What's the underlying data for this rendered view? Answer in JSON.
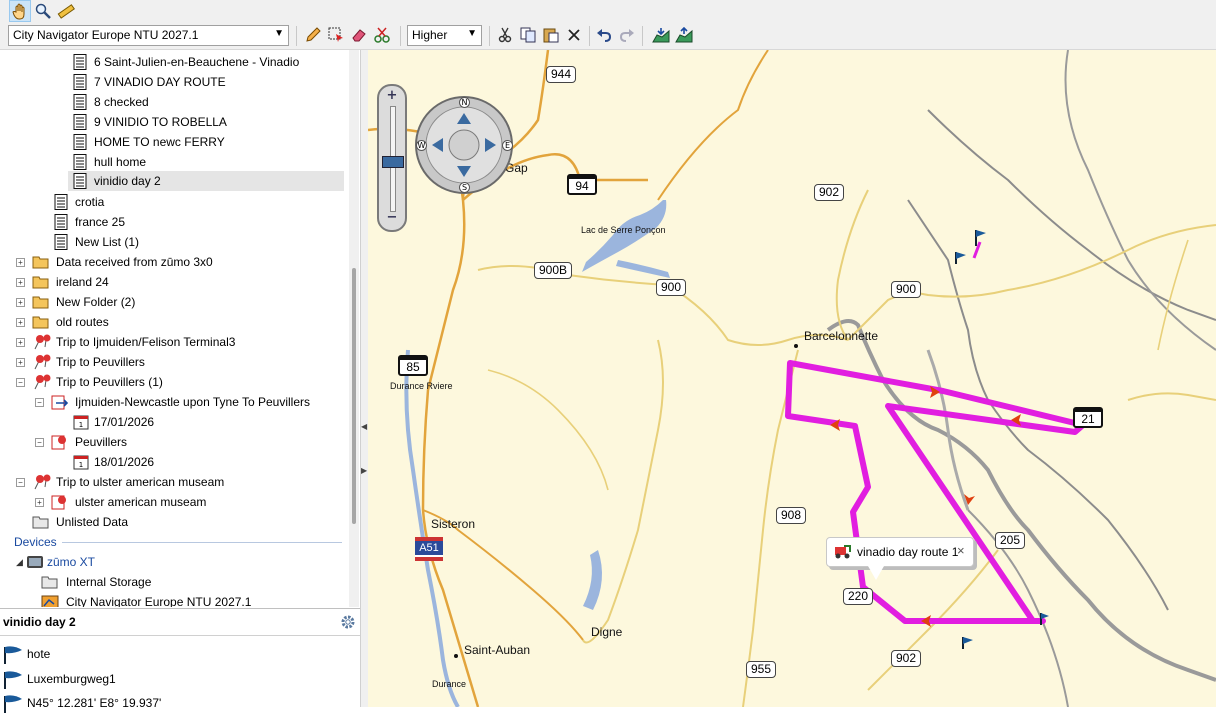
{
  "toolbar": {
    "map_product": "City Navigator Europe NTU 2027.1",
    "detail_level": "Higher"
  },
  "tree": {
    "items": [
      {
        "label": "6 Saint-Julien-en-Beauchene - Vinadio"
      },
      {
        "label": "7 VINADIO DAY ROUTE"
      },
      {
        "label": "8 checked"
      },
      {
        "label": "9 VINIDIO TO ROBELLA"
      },
      {
        "label": "HOME TO  newc FERRY"
      },
      {
        "label": "hull home"
      },
      {
        "label": "vinidio day 2"
      },
      {
        "label": "crotia"
      },
      {
        "label": "france 25"
      },
      {
        "label": "New List (1)"
      },
      {
        "label": "Data received from zūmo 3x0"
      },
      {
        "label": "ireland 24"
      },
      {
        "label": "New Folder (2)"
      },
      {
        "label": "old routes"
      },
      {
        "label": "Trip to Ijmuiden/Felison Terminal3"
      },
      {
        "label": "Trip to Peuvillers"
      },
      {
        "label": "Trip to Peuvillers (1)"
      },
      {
        "label": "Ijmuiden-Newcastle upon Tyne To Peuvillers"
      },
      {
        "label": "17/01/2026"
      },
      {
        "label": "Peuvillers"
      },
      {
        "label": "18/01/2026"
      },
      {
        "label": "Trip to ulster american museam"
      },
      {
        "label": "ulster american museam"
      },
      {
        "label": "Unlisted Data"
      }
    ],
    "devices_header": "Devices",
    "device_name": "zūmo XT",
    "device_items": [
      {
        "label": "Internal Storage"
      },
      {
        "label": "City Navigator Europe NTU 2027.1"
      }
    ]
  },
  "panel": {
    "title": "vinidio day 2",
    "waypoints": [
      {
        "label": "hote"
      },
      {
        "label": "Luxemburgweg1"
      },
      {
        "label": "N45° 12.281' E8° 19.937'"
      }
    ]
  },
  "map": {
    "road_labels": [
      "944",
      "902",
      "900",
      "900B",
      "900",
      "908",
      "205",
      "220",
      "902",
      "955"
    ],
    "shield_labels": [
      "94",
      "85",
      "21"
    ],
    "motorway_label": "A51",
    "places": [
      "Gap",
      "Lac de Serre Ponçon",
      "Barcelonnette",
      "Durance Rviere",
      "Sisteron",
      "Saint-Auban",
      "Digne",
      "Durance"
    ],
    "compass": {
      "n": "N",
      "s": "S",
      "e": "E",
      "w": "W"
    },
    "zoom_plus": "+",
    "zoom_minus": "−",
    "tooltip": "vinadio day route 1",
    "tooltip_close": "×",
    "route_color": "#e11ee0"
  }
}
